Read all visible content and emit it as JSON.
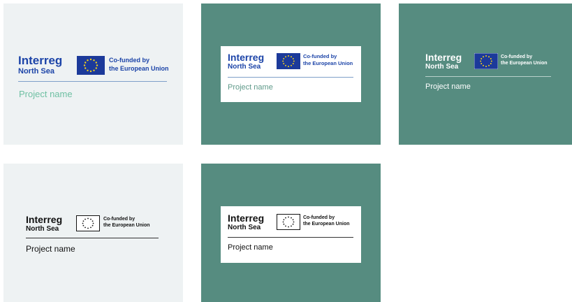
{
  "colors": {
    "page_bg": "#ffffff",
    "light_panel": "#eef2f3",
    "teal_panel": "#568c80",
    "card_white": "#ffffff",
    "interreg_blue": "#1c44a8",
    "eu_blue": "#1c3a9a",
    "eu_star": "#f2cf1c",
    "project_mint": "#6fc0a3",
    "project_teal_text": "#5f9a8a",
    "mono_dark": "#111111",
    "white": "#ffffff"
  },
  "logo": {
    "brand": "Interreg",
    "region": "North Sea",
    "cofund_line1": "Co-funded by",
    "cofund_line2": "the European Union"
  },
  "project_label": "Project name",
  "variants": [
    {
      "name": "color-on-light"
    },
    {
      "name": "color-on-white-card"
    },
    {
      "name": "white-on-teal"
    },
    {
      "name": "mono-on-light"
    },
    {
      "name": "mono-on-white-card"
    }
  ]
}
